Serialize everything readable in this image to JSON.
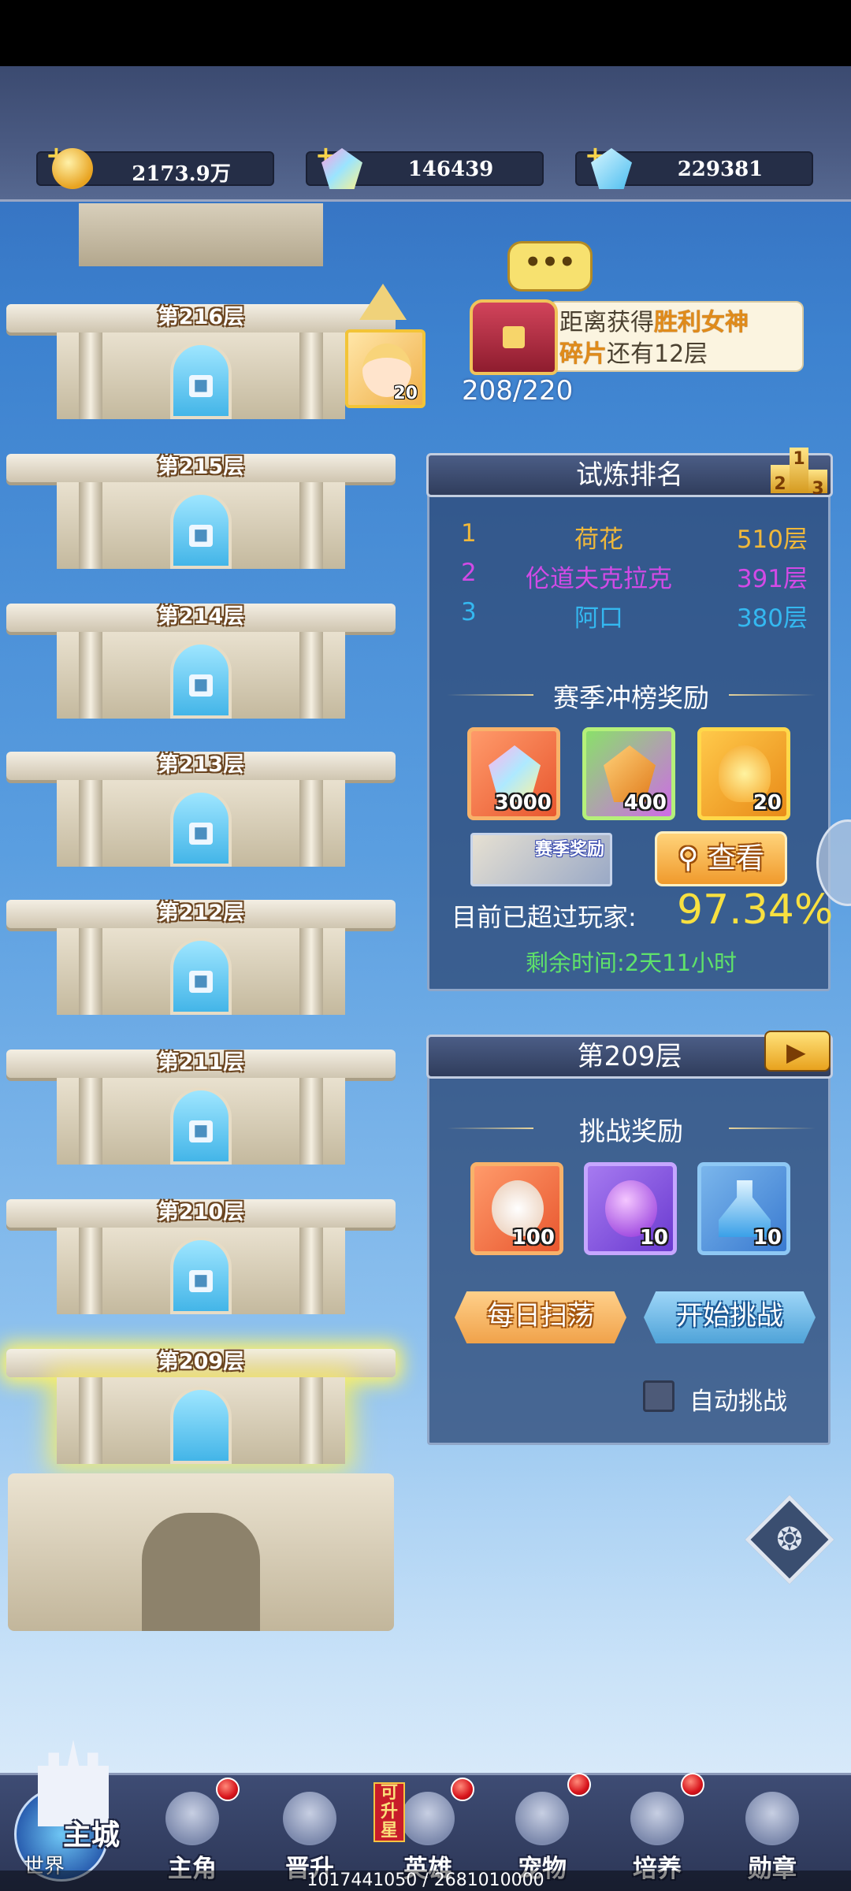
{
  "currencies": [
    {
      "icon": "gold-coin-icon",
      "value": "2173.9万"
    },
    {
      "icon": "rainbow-crystal-icon",
      "value": "146439"
    },
    {
      "icon": "blue-diamond-icon",
      "value": "229381"
    }
  ],
  "tower": {
    "floors": [
      "第216层",
      "第215层",
      "第214层",
      "第213层",
      "第212层",
      "第211层",
      "第210层",
      "第209层"
    ],
    "hero_avatar_level": "20"
  },
  "quest": {
    "speech": "•••",
    "line1_prefix": "距离获得",
    "line1_highlight": "胜利女神",
    "line2_highlight": "碎片",
    "line2_suffix": "还有12层",
    "progress": "208/220"
  },
  "ranking": {
    "title": "试炼排名",
    "podium": [
      "2",
      "1",
      "3"
    ],
    "rows": [
      {
        "rank": "1",
        "name": "荷花",
        "floor": "510层",
        "color": "#f0b83a"
      },
      {
        "rank": "2",
        "name": "伦道夫克拉克",
        "floor": "391层",
        "color": "#d24ae6"
      },
      {
        "rank": "3",
        "name": "阿口",
        "floor": "380层",
        "color": "#34b8f0"
      }
    ],
    "season_title": "赛季冲榜奖励",
    "rewards": [
      {
        "icon": "rainbow-crystal-icon",
        "qty": "3000"
      },
      {
        "icon": "orange-shard-icon",
        "qty": "400"
      },
      {
        "icon": "flame-essence-icon",
        "qty": "20"
      }
    ],
    "season_reward_label": "赛季奖励",
    "view_button": "查看",
    "exceed_label": "目前已超过玩家:",
    "exceed_value": "97.34%",
    "remaining": "剩余时间:2天11小时"
  },
  "challenge": {
    "title": "第209层",
    "rewards_title": "挑战奖励",
    "rewards": [
      {
        "icon": "skull-flame-icon",
        "qty": "100"
      },
      {
        "icon": "purple-orb-icon",
        "qty": "10"
      },
      {
        "icon": "blue-potion-icon",
        "qty": "10"
      }
    ],
    "sweep_button": "每日扫荡",
    "start_button": "开始挑战",
    "auto_label": "自动挑战"
  },
  "nav": {
    "main_city": "主城",
    "world": "世界",
    "items": [
      "主角",
      "晋升",
      "英雄",
      "宠物",
      "培养",
      "勋章"
    ],
    "upstar_badge": "可升星"
  },
  "footer": "1017441050 / 2681010000",
  "colors": {
    "gold": "#f8d34a",
    "exceed_value": "#f8e040",
    "remaining": "#5fe26a",
    "sweep_button": "#f0a24a",
    "start_button": "#4fa3d8"
  }
}
